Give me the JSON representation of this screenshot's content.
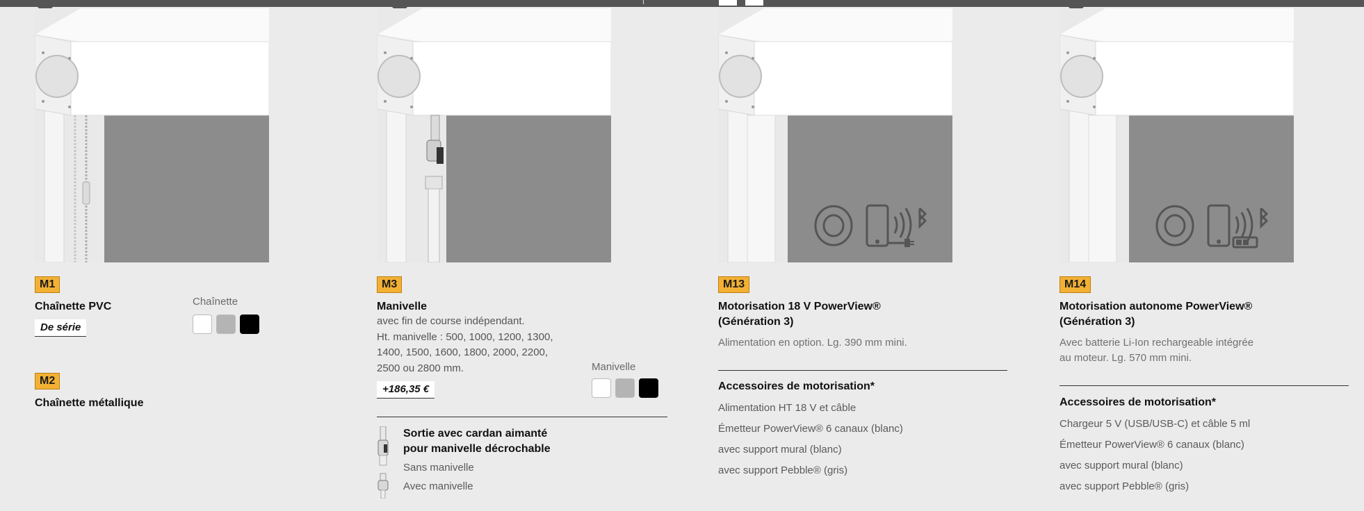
{
  "colors": {
    "badge": "#f2b134",
    "swatch_white": "#ffffff",
    "swatch_gray": "#b4b4b4",
    "swatch_black": "#000000"
  },
  "col1": {
    "m1": {
      "badge": "M1",
      "title": "Chaînette PVC",
      "tag": "De série"
    },
    "swatch_label": "Chaînette",
    "m2": {
      "badge": "M2",
      "title": "Chaînette métallique"
    }
  },
  "col2": {
    "badge": "M3",
    "title": "Manivelle",
    "desc": [
      "avec fin de course indépendant.",
      "Ht. manivelle : 500, 1000, 1200, 1300,",
      "1400, 1500, 1600, 1800, 2000, 2200,",
      "2500 ou 2800 mm."
    ],
    "price": "+186,35 €",
    "swatch_label": "Manivelle",
    "option_title": [
      "Sortie avec cardan aimanté",
      "pour manivelle décrochable"
    ],
    "options": [
      "Sans manivelle",
      "Avec manivelle"
    ]
  },
  "col3": {
    "badge": "M13",
    "title": [
      "Motorisation 18 V PowerView®",
      "(Génération 3)"
    ],
    "desc": "Alimentation en option. Lg. 390 mm mini.",
    "acc_title": "Accessoires de motorisation*",
    "acc": [
      "Alimentation HT 18 V et câble",
      "Émetteur PowerView® 6 canaux (blanc)",
      "avec support mural (blanc)",
      "avec support Pebble® (gris)"
    ]
  },
  "col4": {
    "badge": "M14",
    "title": [
      "Motorisation autonome PowerView®",
      "(Génération 3)"
    ],
    "desc": [
      "Avec batterie Li-Ion rechargeable intégrée",
      "au moteur. Lg. 570 mm mini."
    ],
    "acc_title": "Accessoires de motorisation*",
    "acc": [
      "Chargeur 5 V (USB/USB-C) et câble 5 ml",
      "Émetteur PowerView® 6 canaux (blanc)",
      "avec support mural (blanc)",
      "avec support Pebble® (gris)"
    ]
  }
}
